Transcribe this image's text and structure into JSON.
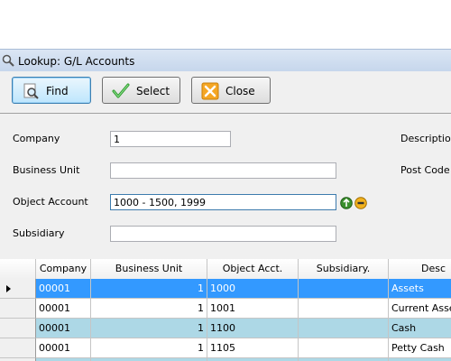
{
  "window": {
    "title": "Lookup: G/L Accounts"
  },
  "toolbar": {
    "find_label": "Find",
    "select_label": "Select",
    "close_label": "Close"
  },
  "filters": {
    "company": {
      "label": "Company",
      "value": "1"
    },
    "business_unit": {
      "label": "Business Unit",
      "value": ""
    },
    "object_account": {
      "label": "Object Account",
      "value": "1000 - 1500, 1999"
    },
    "subsidiary": {
      "label": "Subsidiary",
      "value": ""
    },
    "description_label": "Description",
    "post_code_label": "Post Code"
  },
  "grid": {
    "columns": [
      "Company",
      "Business Unit",
      "Object Acct.",
      "Subsidiary.",
      "Desc"
    ],
    "rows": [
      {
        "company": "00001",
        "business_unit": "1",
        "object_acct": "1000",
        "subsidiary": "",
        "description": "Assets",
        "state": "selected"
      },
      {
        "company": "00001",
        "business_unit": "1",
        "object_acct": "1001",
        "subsidiary": "",
        "description": "Current Assets",
        "state": "plain"
      },
      {
        "company": "00001",
        "business_unit": "1",
        "object_acct": "1100",
        "subsidiary": "",
        "description": "Cash",
        "state": "alt"
      },
      {
        "company": "00001",
        "business_unit": "1",
        "object_acct": "1105",
        "subsidiary": "",
        "description": "Petty Cash",
        "state": "plain"
      },
      {
        "company": "",
        "business_unit": "",
        "object_acct": "",
        "subsidiary": "",
        "description": "",
        "state": "alt"
      }
    ]
  },
  "colors": {
    "selected_row": "#3399ff",
    "alt_row": "#add8e6",
    "title_bar": "#c6d6ec"
  },
  "icons": {
    "title": "magnifier-icon",
    "find": "magnifier-doc-icon",
    "select": "checkmark-icon",
    "close": "x-icon",
    "go": "green-arrow-icon",
    "clear": "minus-icon"
  }
}
